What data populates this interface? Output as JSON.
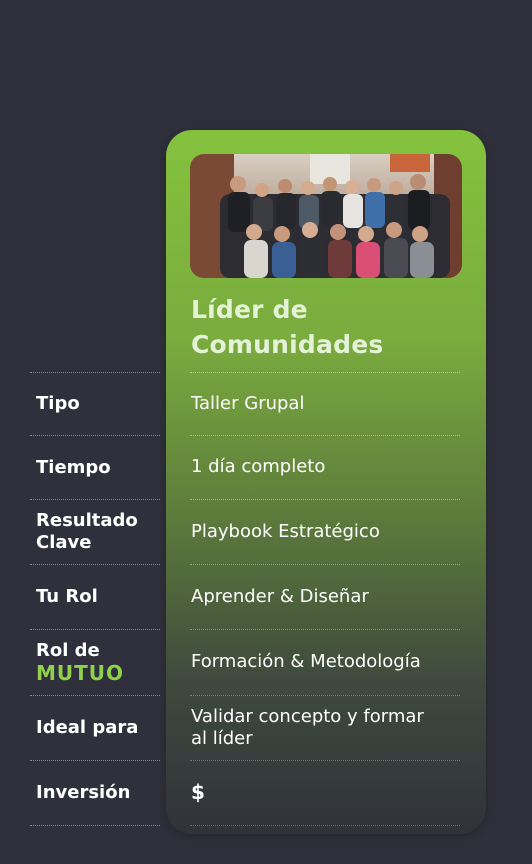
{
  "card": {
    "title_line1": "Líder de",
    "title_line2": "Comunidades",
    "accent_color": "#84c23d"
  },
  "photo": {
    "description_icon": "group-photo"
  },
  "rows": [
    {
      "label": "Tipo",
      "value": "Taller Grupal"
    },
    {
      "label": "Tiempo",
      "value": "1 día completo"
    },
    {
      "label_line1": "Resultado",
      "label_line2": "Clave",
      "value": "Playbook Estratégico"
    },
    {
      "label": "Tu Rol",
      "value": "Aprender & Diseñar"
    },
    {
      "label_line1": "Rol de",
      "logo_text": "MUTUO",
      "value": "Formación & Metodología"
    },
    {
      "label": "Ideal para",
      "value_line1": "Validar concepto y formar",
      "value_line2": "al líder"
    },
    {
      "label": "Inversión",
      "value": "$"
    }
  ]
}
